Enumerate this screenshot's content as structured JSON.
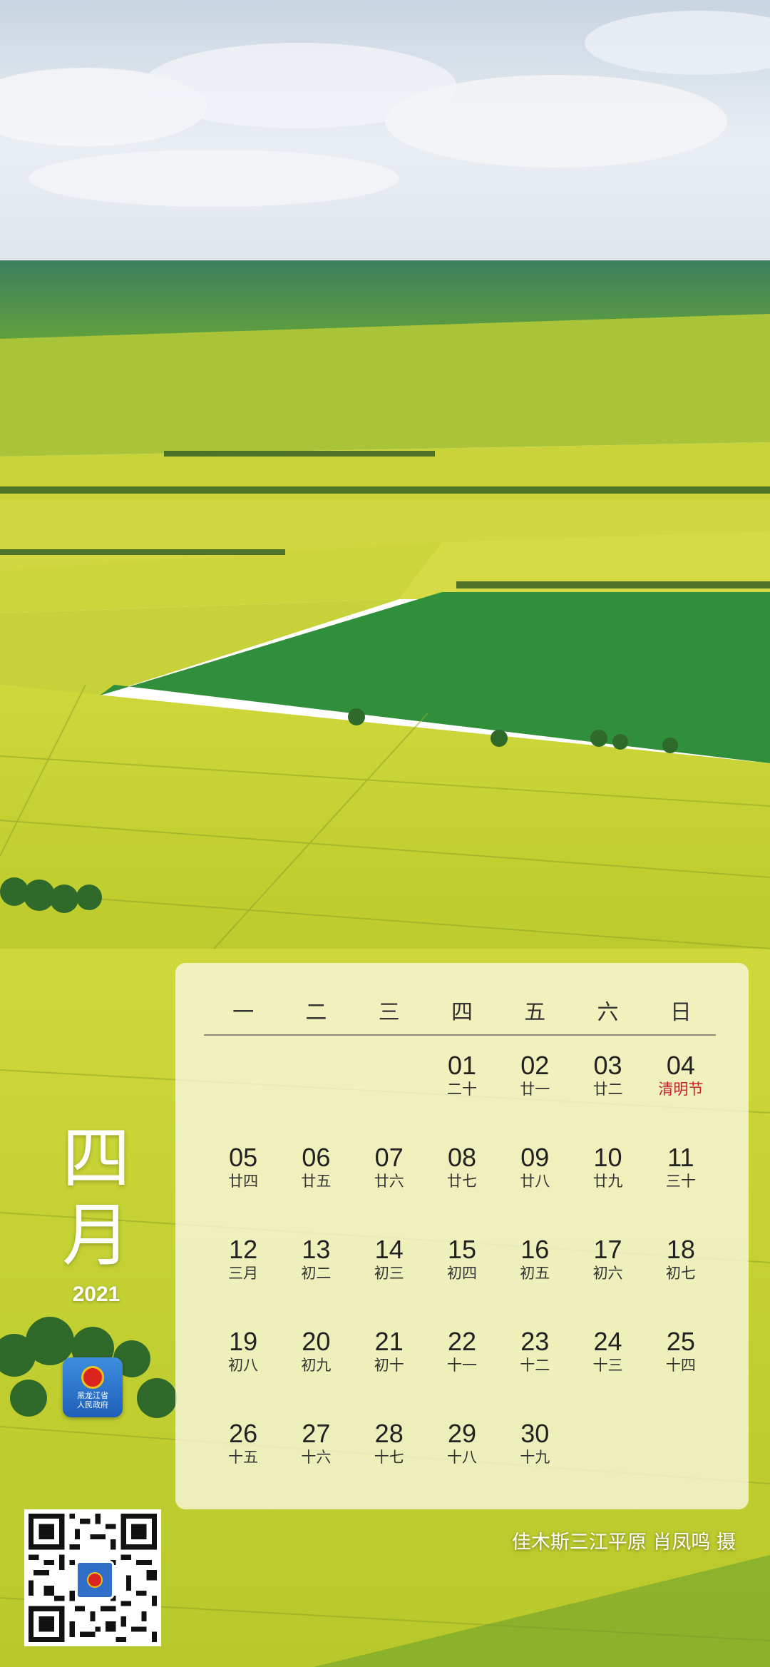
{
  "month": {
    "chars": [
      "四",
      "月"
    ],
    "year": "2021"
  },
  "gov_logo": {
    "line1": "黑龙江省",
    "line2": "人民政府"
  },
  "calendar": {
    "weekdays": [
      "一",
      "二",
      "三",
      "四",
      "五",
      "六",
      "日"
    ],
    "leading_blanks": 3,
    "days": [
      {
        "num": "01",
        "lunar": "二十"
      },
      {
        "num": "02",
        "lunar": "廿一"
      },
      {
        "num": "03",
        "lunar": "廿二"
      },
      {
        "num": "04",
        "lunar": "清明节",
        "holiday": true
      },
      {
        "num": "05",
        "lunar": "廿四"
      },
      {
        "num": "06",
        "lunar": "廿五"
      },
      {
        "num": "07",
        "lunar": "廿六"
      },
      {
        "num": "08",
        "lunar": "廿七"
      },
      {
        "num": "09",
        "lunar": "廿八"
      },
      {
        "num": "10",
        "lunar": "廿九"
      },
      {
        "num": "11",
        "lunar": "三十"
      },
      {
        "num": "12",
        "lunar": "三月"
      },
      {
        "num": "13",
        "lunar": "初二"
      },
      {
        "num": "14",
        "lunar": "初三"
      },
      {
        "num": "15",
        "lunar": "初四"
      },
      {
        "num": "16",
        "lunar": "初五"
      },
      {
        "num": "17",
        "lunar": "初六"
      },
      {
        "num": "18",
        "lunar": "初七"
      },
      {
        "num": "19",
        "lunar": "初八"
      },
      {
        "num": "20",
        "lunar": "初九"
      },
      {
        "num": "21",
        "lunar": "初十"
      },
      {
        "num": "22",
        "lunar": "十一"
      },
      {
        "num": "23",
        "lunar": "十二"
      },
      {
        "num": "24",
        "lunar": "十三"
      },
      {
        "num": "25",
        "lunar": "十四"
      },
      {
        "num": "26",
        "lunar": "十五"
      },
      {
        "num": "27",
        "lunar": "十六"
      },
      {
        "num": "28",
        "lunar": "十七"
      },
      {
        "num": "29",
        "lunar": "十八"
      },
      {
        "num": "30",
        "lunar": "十九"
      }
    ]
  },
  "caption": "佳木斯三江平原  肖凤鸣 摄",
  "colors": {
    "holiday": "#c8202a",
    "panel": "#faf8e1",
    "sky": "#dfe7ef",
    "field_green": "#3f8f3a",
    "field_yellow": "#c9d634"
  }
}
